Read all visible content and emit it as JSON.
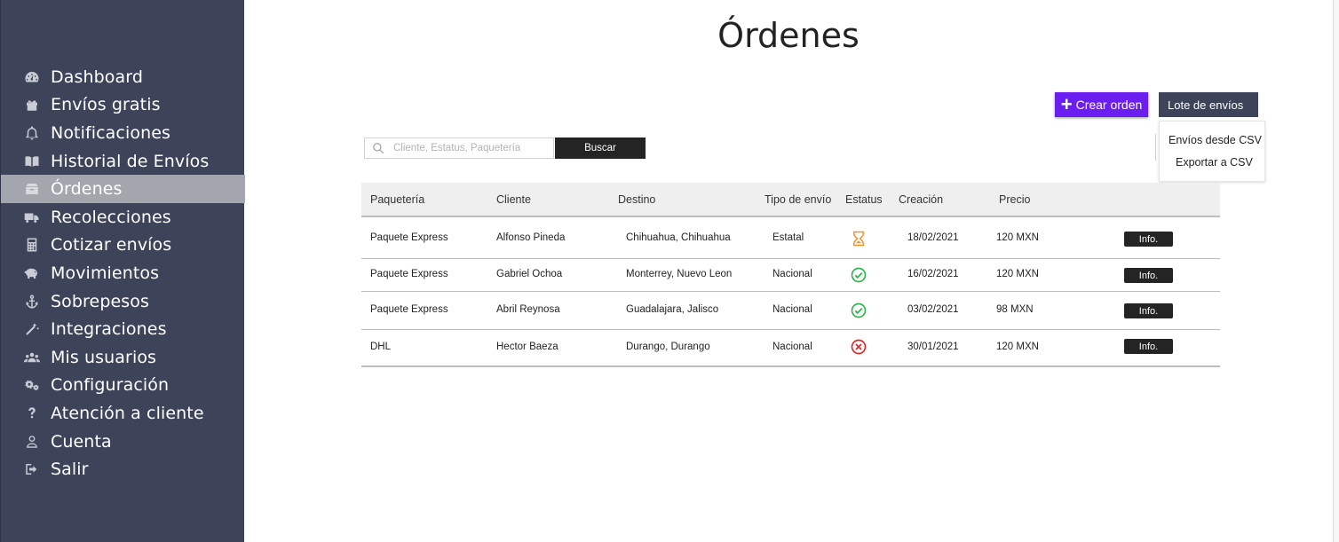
{
  "sidebar": {
    "items": [
      {
        "label": "Dashboard",
        "icon": "dashboard-icon"
      },
      {
        "label": "Envíos gratis",
        "icon": "gift-icon"
      },
      {
        "label": "Notificaciones",
        "icon": "bell-icon"
      },
      {
        "label": "Historial de Envíos",
        "icon": "book-icon"
      },
      {
        "label": "Órdenes",
        "icon": "box-icon",
        "active": true
      },
      {
        "label": "Recolecciones",
        "icon": "truck-icon"
      },
      {
        "label": "Cotizar envíos",
        "icon": "calculator-icon"
      },
      {
        "label": "Movimientos",
        "icon": "piggy-bank-icon"
      },
      {
        "label": "Sobrepesos",
        "icon": "anchor-icon"
      },
      {
        "label": "Integraciones",
        "icon": "magic-wand-icon"
      },
      {
        "label": "Mis usuarios",
        "icon": "users-icon"
      },
      {
        "label": "Configuración",
        "icon": "gears-icon"
      },
      {
        "label": "Atención a cliente",
        "icon": "question-icon"
      },
      {
        "label": "Cuenta",
        "icon": "user-icon"
      },
      {
        "label": "Salir",
        "icon": "sign-out-icon"
      }
    ]
  },
  "page": {
    "title": "Órdenes"
  },
  "toolbar": {
    "create_label": "Crear orden",
    "batch_label": "Lote de envíos",
    "dropdown": [
      "Envíos desde CSV",
      "Exportar a CSV"
    ]
  },
  "search": {
    "placeholder": "Cliente, Estatus, Paquetería",
    "value": "",
    "button_label": "Buscar"
  },
  "table": {
    "headers": [
      "Paquetería",
      "Cliente",
      "Destino",
      "Tipo de envío",
      "Estatus",
      "Creación",
      "Precio"
    ],
    "rows": [
      {
        "carrier": "Paquete Express",
        "client": "Alfonso Pineda",
        "destination": "Chihuahua, Chihuahua",
        "type": "Estatal",
        "status": "pending",
        "status_icon": "hourglass-icon",
        "created": "18/02/2021",
        "price": "120 MXN",
        "action": "Info."
      },
      {
        "carrier": "Paquete Express",
        "client": "Gabriel Ochoa",
        "destination": "Monterrey, Nuevo Leon",
        "type": "Nacional",
        "status": "delivered",
        "status_icon": "check-circle-icon",
        "created": "16/02/2021",
        "price": "120 MXN",
        "action": "Info."
      },
      {
        "carrier": "Paquete Express",
        "client": "Abril Reynosa",
        "destination": "Guadalajara, Jalisco",
        "type": "Nacional",
        "status": "delivered",
        "status_icon": "check-circle-icon",
        "created": "03/02/2021",
        "price": "98 MXN",
        "action": "Info."
      },
      {
        "carrier": "DHL",
        "client": "Hector Baeza",
        "destination": "Durango, Durango",
        "type": "Nacional",
        "status": "cancelled",
        "status_icon": "x-circle-icon",
        "created": "30/01/2021",
        "price": "120 MXN",
        "action": "Info."
      }
    ]
  },
  "colors": {
    "sidebar_bg": "#3d4459",
    "sidebar_active": "#a3a6ad",
    "accent": "#6a1ff0",
    "pending": "#f0932b",
    "success": "#2eb44a",
    "error": "#e0262a"
  }
}
